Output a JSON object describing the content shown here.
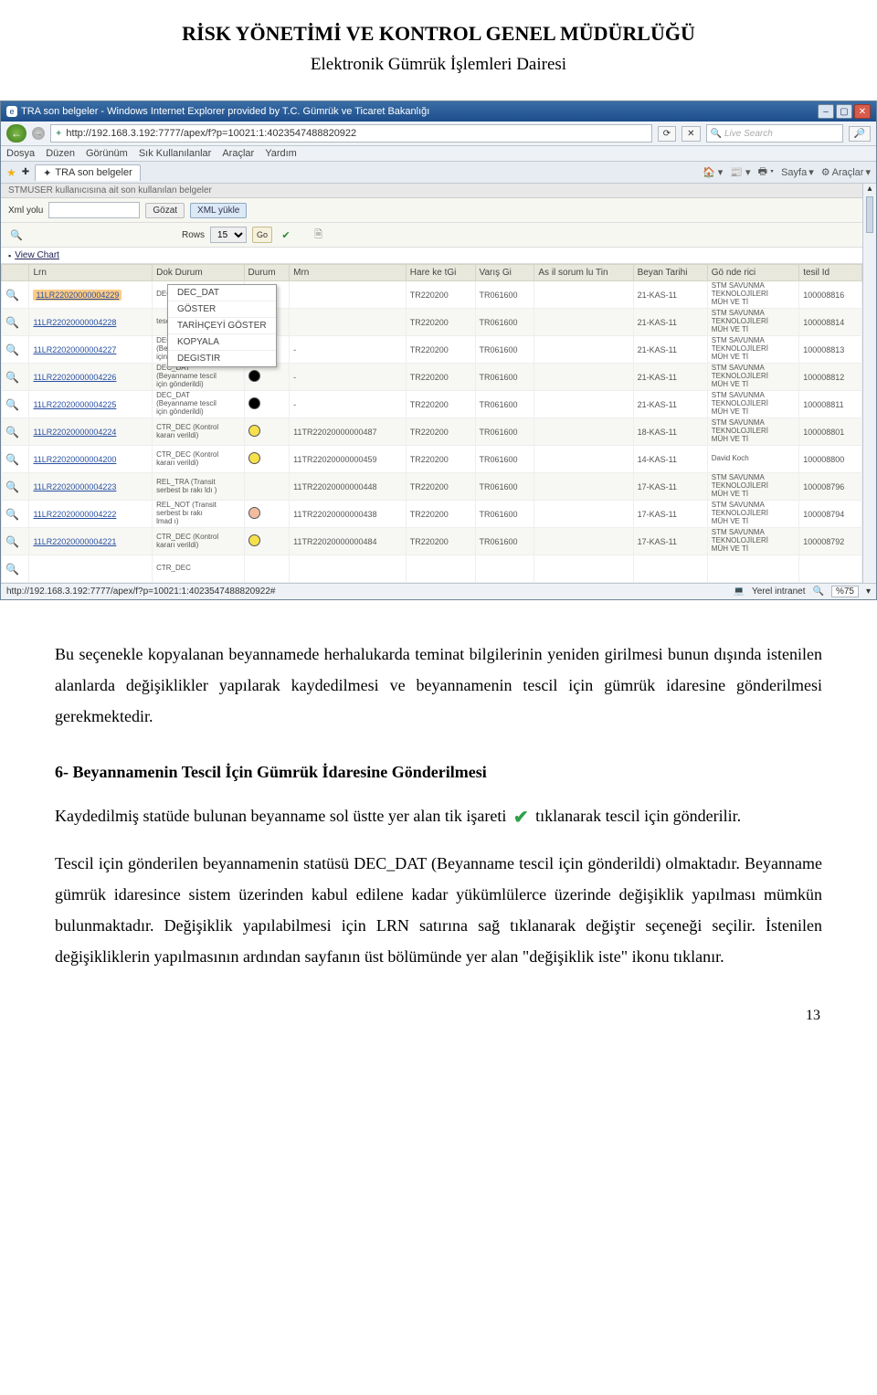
{
  "header": {
    "title": "RİSK YÖNETİMİ VE KONTROL GENEL MÜDÜRLÜĞÜ",
    "subtitle": "Elektronik Gümrük İşlemleri Dairesi"
  },
  "browser": {
    "window_title": "TRA son belgeler - Windows Internet Explorer provided by T.C. Gümrük ve Ticaret Bakanlığı",
    "url": "http://192.168.3.192:7777/apex/f?p=10021:1:4023547488820922",
    "search_placeholder": "Live Search",
    "menubar": [
      "Dosya",
      "Düzen",
      "Görünüm",
      "Sık Kullanılanlar",
      "Araçlar",
      "Yardım"
    ],
    "tab_label": "TRA son belgeler",
    "toolbar_right": [
      "Sayfa",
      "Araçlar"
    ],
    "status_url": "http://192.168.3.192:7777/apex/f?p=10021:1:4023547488820922#",
    "status_zone": "Yerel intranet",
    "status_zoom": "%75"
  },
  "app": {
    "section_header": "STMUSER kullanıcısına ait son kullanılan belgeler",
    "xml_label": "Xml yolu",
    "btn_browse": "Gözat",
    "btn_xml_upload": "XML yükle",
    "rows_label": "Rows",
    "rows_value": "15",
    "go_label": "Go",
    "view_chart": "View Chart",
    "columns": [
      "",
      "Lrn",
      "Dok Durum",
      "Durum",
      "Mrn",
      "Hare ke tGi",
      "Varış Gi",
      "As il sorum lu Tin",
      "Beyan Tarihi",
      "Gö nde rici",
      "tesil Id"
    ],
    "context_menu": [
      "DEC_DAT",
      "GÖSTER",
      "TARİHÇEYİ GÖSTER",
      "KOPYALA",
      "DEGISTIR"
    ],
    "rows": [
      {
        "lrn": "11LR22020000004229",
        "ddurum": "DEĞİŞTİR",
        "durum": "",
        "mrn": "",
        "hg": "TR220200",
        "vg": "TR061600",
        "ast": "",
        "tarih": "21-KAS-11",
        "gon": "STM SAVUNMA TEKNOLOJİLERİ MÜH VE Tİ",
        "tid": "100008816",
        "hl": true
      },
      {
        "lrn": "11LR22020000004228",
        "ddurum": "tescil için gönderildi",
        "durum": "black",
        "mrn": "",
        "hg": "TR220200",
        "vg": "TR061600",
        "ast": "",
        "tarih": "21-KAS-11",
        "gon": "STM SAVUNMA TEKNOLOJİLERİ MÜH VE Tİ",
        "tid": "100008814"
      },
      {
        "lrn": "11LR22020000004227",
        "ddurum": "DEC_DAT (Beyanname tescil için gönderildi)",
        "durum": "black",
        "mrn": "-",
        "hg": "TR220200",
        "vg": "TR061600",
        "ast": "",
        "tarih": "21-KAS-11",
        "gon": "STM SAVUNMA TEKNOLOJİLERİ MÜH VE Tİ",
        "tid": "100008813"
      },
      {
        "lrn": "11LR22020000004226",
        "ddurum": "DEC_DAT (Beyanname tescil için gönderildi)",
        "durum": "black",
        "mrn": "-",
        "hg": "TR220200",
        "vg": "TR061600",
        "ast": "",
        "tarih": "21-KAS-11",
        "gon": "STM SAVUNMA TEKNOLOJİLERİ MÜH VE Tİ",
        "tid": "100008812"
      },
      {
        "lrn": "11LR22020000004225",
        "ddurum": "DEC_DAT (Beyanname tescil için gönderildi)",
        "durum": "black",
        "mrn": "-",
        "hg": "TR220200",
        "vg": "TR061600",
        "ast": "",
        "tarih": "21-KAS-11",
        "gon": "STM SAVUNMA TEKNOLOJİLERİ MÜH VE Tİ",
        "tid": "100008811"
      },
      {
        "lrn": "11LR22020000004224",
        "ddurum": "CTR_DEC (Kontrol kararı verildi)",
        "durum": "yellow",
        "mrn": "11TR22020000000487",
        "hg": "TR220200",
        "vg": "TR061600",
        "ast": "",
        "tarih": "18-KAS-11",
        "gon": "STM SAVUNMA TEKNOLOJİLERİ MÜH VE Tİ",
        "tid": "100008801"
      },
      {
        "lrn": "11LR22020000004200",
        "ddurum": "CTR_DEC (Kontrol kararı verildi)",
        "durum": "yellow",
        "mrn": "11TR22020000000459",
        "hg": "TR220200",
        "vg": "TR061600",
        "ast": "",
        "tarih": "14-KAS-11",
        "gon": "David Koch",
        "tid": "100008800"
      },
      {
        "lrn": "11LR22020000004223",
        "ddurum": "REL_TRA (Transit serbest bı rakı ldı )",
        "durum": "",
        "mrn": "11TR22020000000448",
        "hg": "TR220200",
        "vg": "TR061600",
        "ast": "",
        "tarih": "17-KAS-11",
        "gon": "STM SAVUNMA TEKNOLOJİLERİ MÜH VE Tİ",
        "tid": "100008796"
      },
      {
        "lrn": "11LR22020000004222",
        "ddurum": "REL_NOT (Transit serbest bı rakı lmad ı)",
        "durum": "orange",
        "mrn": "11TR22020000000438",
        "hg": "TR220200",
        "vg": "TR061600",
        "ast": "",
        "tarih": "17-KAS-11",
        "gon": "STM SAVUNMA TEKNOLOJİLERİ MÜH VE Tİ",
        "tid": "100008794"
      },
      {
        "lrn": "11LR22020000004221",
        "ddurum": "CTR_DEC (Kontrol kararı verildi)",
        "durum": "yellow",
        "mrn": "11TR22020000000484",
        "hg": "TR220200",
        "vg": "TR061600",
        "ast": "",
        "tarih": "17-KAS-11",
        "gon": "STM SAVUNMA TEKNOLOJİLERİ MÜH VE Tİ",
        "tid": "100008792"
      },
      {
        "lrn": "",
        "ddurum": "CTR_DEC",
        "durum": "",
        "mrn": "",
        "hg": "",
        "vg": "",
        "ast": "",
        "tarih": "",
        "gon": "",
        "tid": ""
      }
    ]
  },
  "body": {
    "p1": "Bu seçenekle kopyalanan beyannamede herhalukarda teminat bilgilerinin yeniden girilmesi bunun dışında istenilen alanlarda değişiklikler yapılarak kaydedilmesi ve beyannamenin tescil için gümrük idaresine gönderilmesi gerekmektedir.",
    "sec6": "6- Beyannamenin Tescil İçin Gümrük İdaresine Gönderilmesi",
    "p2a": "Kaydedilmiş statüde bulunan beyanname sol üstte yer alan tik işareti",
    "p2b": "tıklanarak tescil için gönderilir.",
    "p3": "Tescil için gönderilen beyannamenin statüsü DEC_DAT (Beyanname tescil için gönderildi) olmaktadır. Beyanname gümrük idaresince sistem üzerinden kabul edilene kadar yükümlülerce üzerinde değişiklik yapılması mümkün bulunmaktadır. Değişiklik yapılabilmesi için LRN satırına sağ tıklanarak değiştir seçeneği seçilir. İstenilen değişikliklerin yapılmasının ardından sayfanın üst bölümünde yer alan \"değişiklik iste\" ikonu tıklanır.",
    "pagenum": "13"
  }
}
